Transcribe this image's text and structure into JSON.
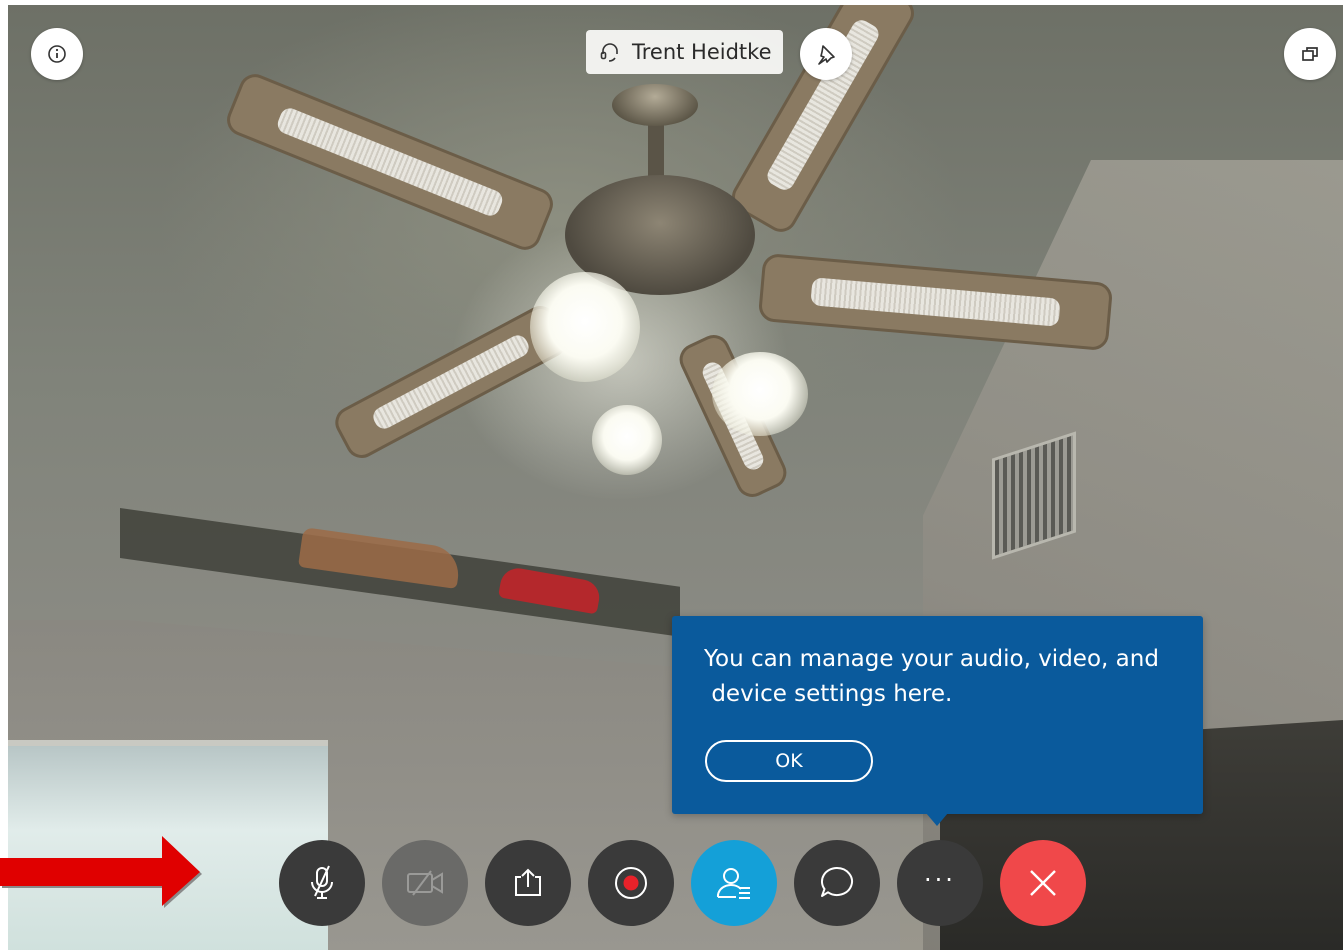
{
  "participant": {
    "name": "Trent Heidtke"
  },
  "tooltip": {
    "message": "You can manage your audio, video, and\n device settings here.",
    "ok_label": "OK"
  },
  "controls": [
    {
      "name": "mute-button",
      "icon": "microphone-muted-icon"
    },
    {
      "name": "video-button",
      "icon": "video-off-icon"
    },
    {
      "name": "share-button",
      "icon": "share-content-icon"
    },
    {
      "name": "record-button",
      "icon": "record-icon"
    },
    {
      "name": "participants-button",
      "icon": "participants-icon"
    },
    {
      "name": "chat-button",
      "icon": "chat-bubble-icon"
    },
    {
      "name": "more-options-button",
      "icon": "more-dots-icon",
      "label": "···"
    },
    {
      "name": "end-call-button",
      "icon": "close-x-icon"
    }
  ],
  "colors": {
    "tooltip_bg": "#0a5a9c",
    "participants_active": "#14a0d8",
    "end_call": "#f0484a",
    "record_dot": "#e8222a",
    "annotation_arrow": "#e00000"
  }
}
